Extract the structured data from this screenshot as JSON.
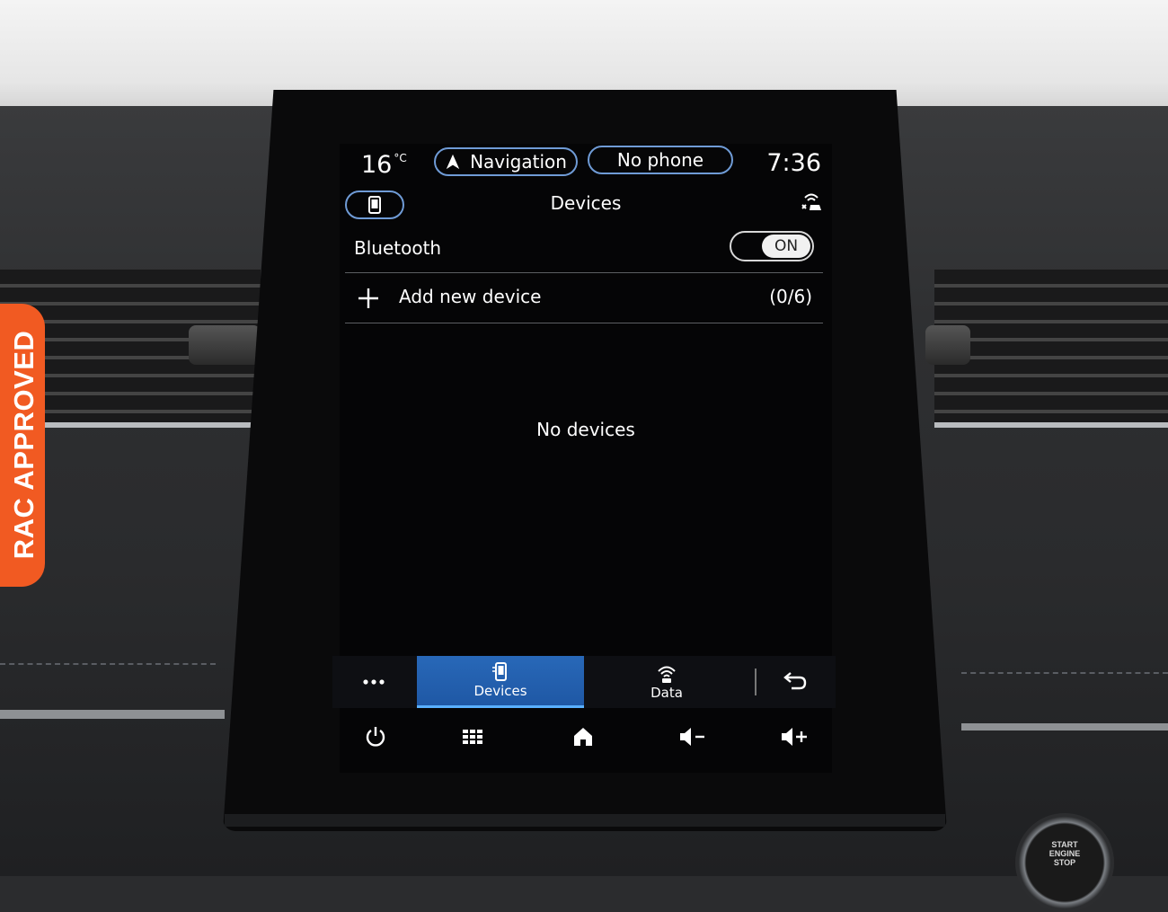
{
  "status_bar": {
    "temperature": "16",
    "temperature_unit": "°C",
    "navigation_label": "Navigation",
    "phone_label": "No phone",
    "clock": "7:36"
  },
  "header": {
    "title": "Devices"
  },
  "bluetooth": {
    "label": "Bluetooth",
    "toggle_state": "ON"
  },
  "add_device": {
    "label": "Add new device",
    "count": "(0/6)"
  },
  "empty_state": "No devices",
  "tabs": [
    {
      "label": "",
      "icon": "more-dots-icon"
    },
    {
      "label": "Devices",
      "icon": "phone-icon",
      "active": true
    },
    {
      "label": "Data",
      "icon": "wireless-data-icon"
    },
    {
      "label": "",
      "icon": "back-icon"
    }
  ],
  "system_buttons": [
    "power-icon",
    "apps-grid-icon",
    "home-icon",
    "volume-down-icon",
    "volume-up-icon"
  ],
  "badge": {
    "text": "RAC APPROVED",
    "color": "#f15a22"
  },
  "start_button_label": "START\nENGINE\nSTOP",
  "colors": {
    "accent_outline": "#6f9bd6",
    "active_tab": "#2868b8"
  }
}
